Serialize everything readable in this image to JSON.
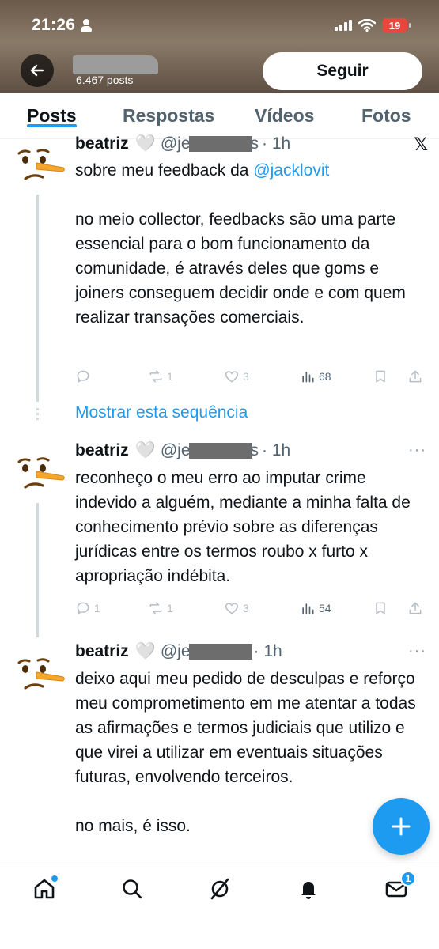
{
  "status_bar": {
    "time": "21:26",
    "battery": "19"
  },
  "profile": {
    "post_count": "6.467 posts",
    "follow_label": "Seguir"
  },
  "tabs": [
    {
      "label": "Posts",
      "active": true
    },
    {
      "label": "Respostas",
      "active": false
    },
    {
      "label": "Vídeos",
      "active": false
    },
    {
      "label": "Fotos",
      "active": false
    }
  ],
  "tweets": [
    {
      "name": "beatriz",
      "heart": "🤍",
      "handle_prefix": "@je",
      "handle_suffix": "s",
      "time": "· 1h",
      "text_before": "sobre meu feedback da ",
      "mention": "@jacklovit",
      "text_after": "\n\nno meio collector, feedbacks são uma parte essencial para o bom funcionamento da comunidade, é através deles que goms e joiners conseguem decidir onde e com quem realizar transações comerciais.",
      "replies": "",
      "reposts": "1",
      "likes": "3",
      "views": "68"
    },
    {
      "name": "beatriz",
      "heart": "🤍",
      "handle_prefix": "@je",
      "handle_suffix": "s",
      "time": "· 1h",
      "text": "reconheço o meu erro ao imputar crime indevido a alguém, mediante a minha falta de conhecimento prévio sobre as diferenças jurídicas entre os termos roubo x furto x apropriação indébita.",
      "replies": "1",
      "reposts": "1",
      "likes": "3",
      "views": "54"
    },
    {
      "name": "beatriz",
      "heart": "🤍",
      "handle_prefix": "@je",
      "handle_suffix": "",
      "time": "· 1h",
      "text": "deixo aqui meu pedido de desculpas e reforço meu comprometimento em me atentar a todas as afirmações e termos judiciais que utilizo e que virei a utilizar em eventuais situações futuras, envolvendo terceiros.\n\nno mais, é isso."
    }
  ],
  "show_thread_label": "Mostrar esta sequência",
  "more_glyph": "···",
  "x_glyph": "𝕏",
  "nav": {
    "messages_badge": "1"
  },
  "colors": {
    "accent": "#1d9bf0",
    "text": "#0f1419",
    "secondary": "#536471"
  }
}
